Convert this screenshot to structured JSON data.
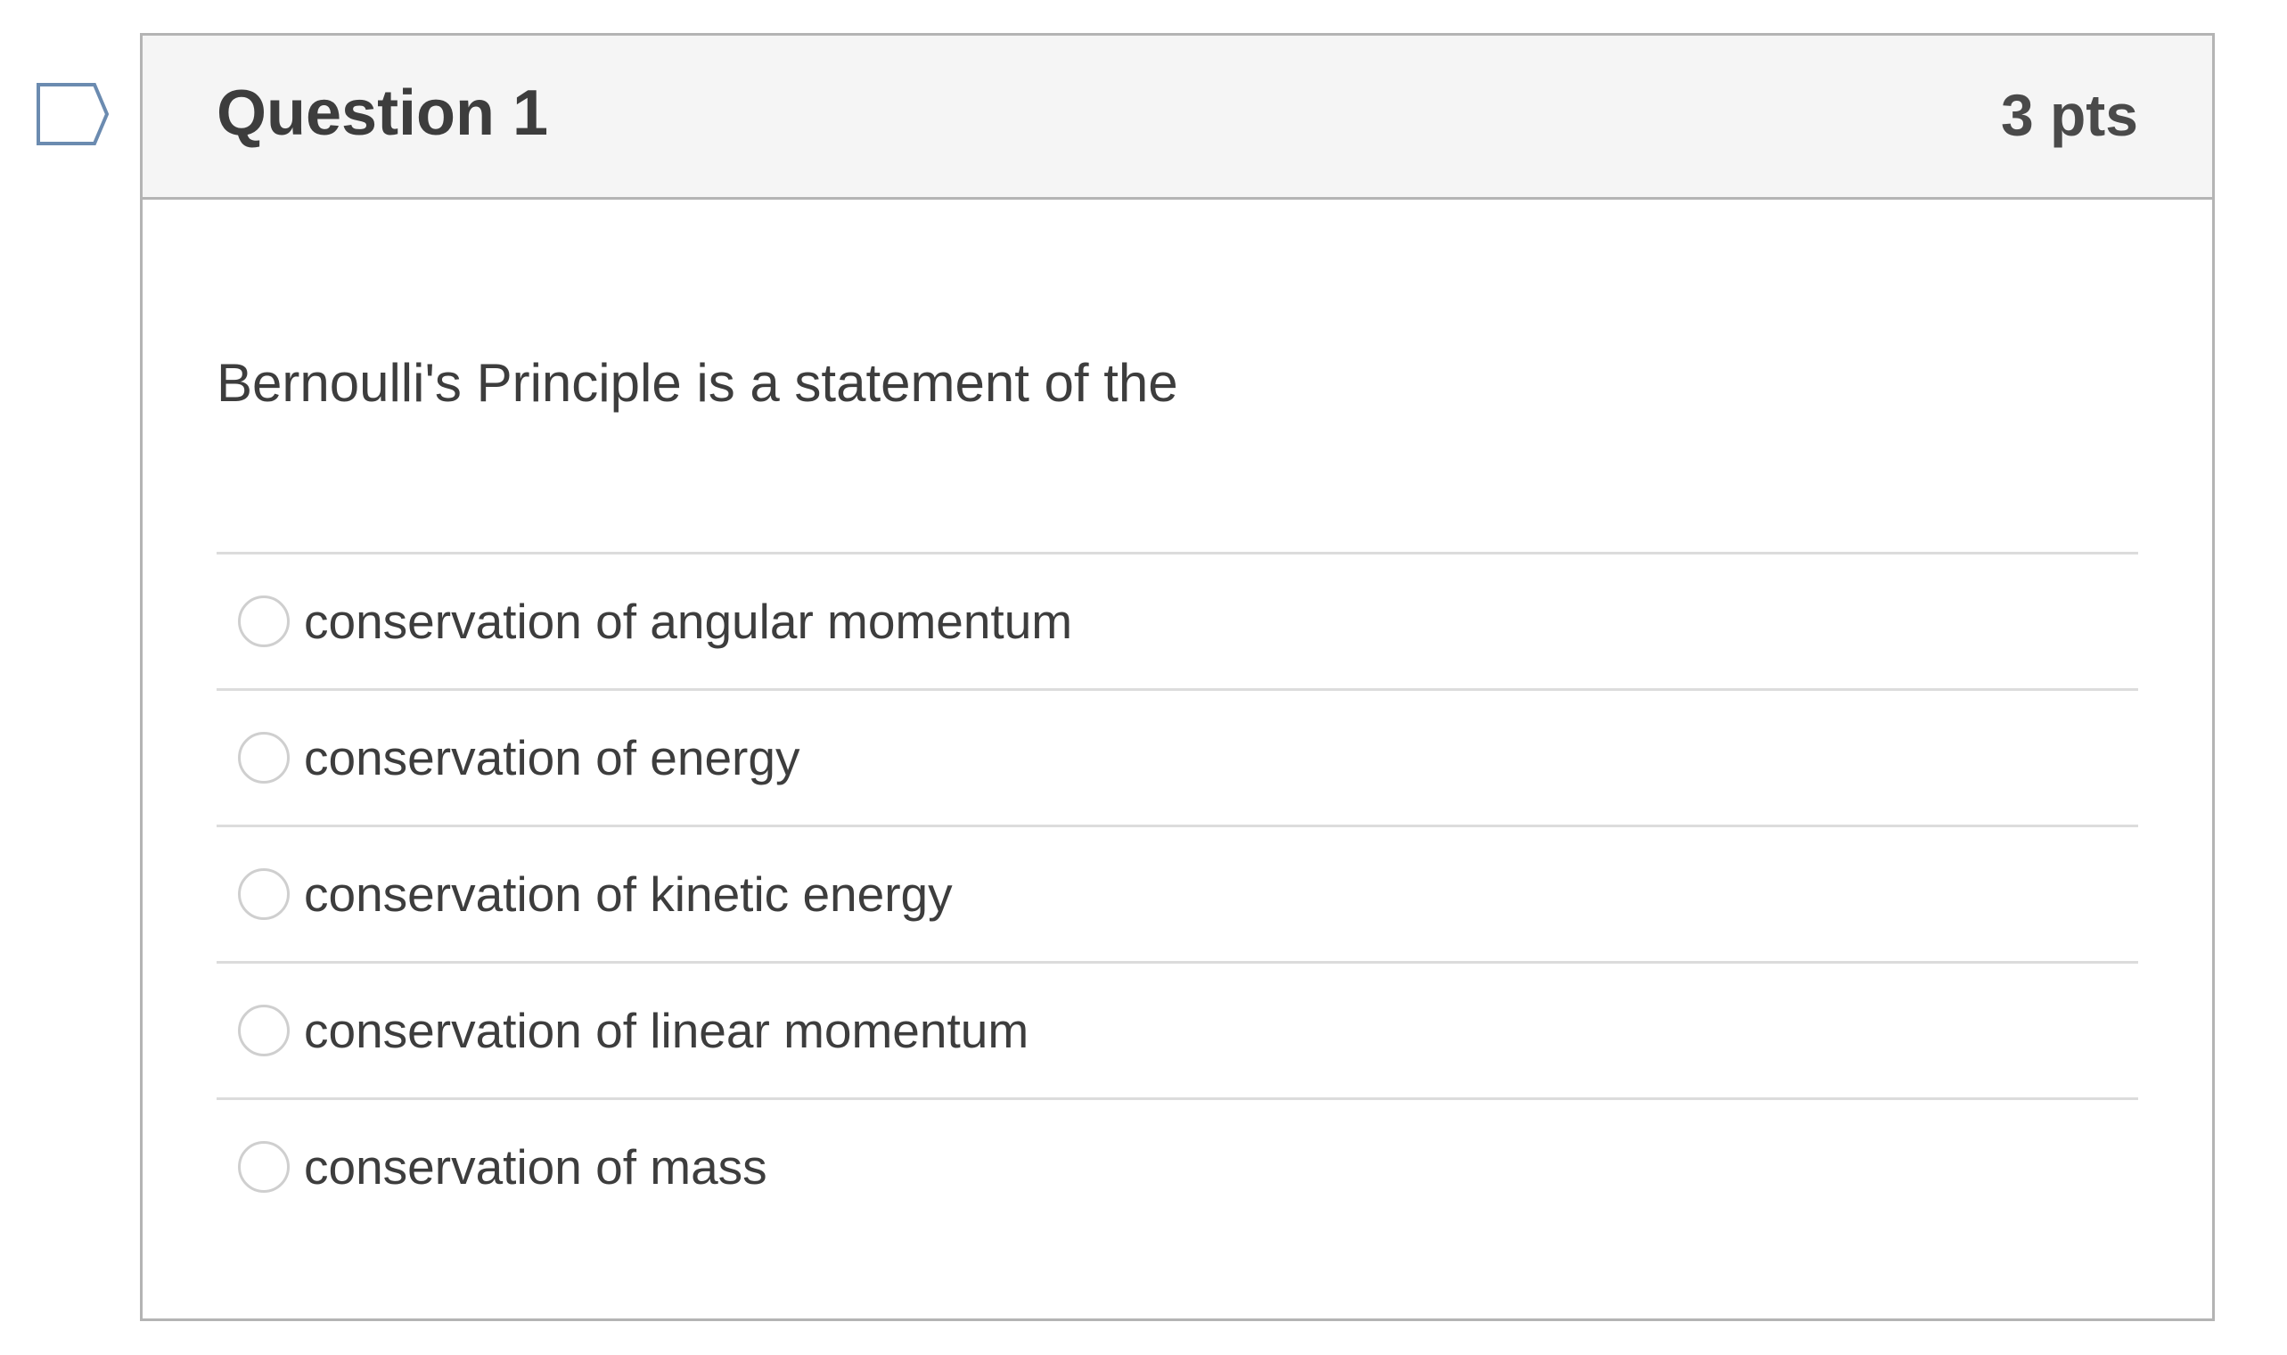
{
  "question": {
    "title": "Question 1",
    "points": "3 pts",
    "text": "Bernoulli's Principle is a statement of the",
    "flag_icon": "bookmark-flag-icon",
    "answers": [
      {
        "label": "conservation of angular momentum",
        "selected": false
      },
      {
        "label": "conservation of energy",
        "selected": false
      },
      {
        "label": "conservation of kinetic energy",
        "selected": false
      },
      {
        "label": "conservation of linear momentum",
        "selected": false
      },
      {
        "label": "conservation of mass",
        "selected": false
      }
    ]
  },
  "colors": {
    "header_bg": "#f5f5f5",
    "border": "#b4b4b4",
    "divider": "#dcdcdc",
    "text": "#3d3d3d",
    "flag_stroke": "#6b8bb0"
  }
}
